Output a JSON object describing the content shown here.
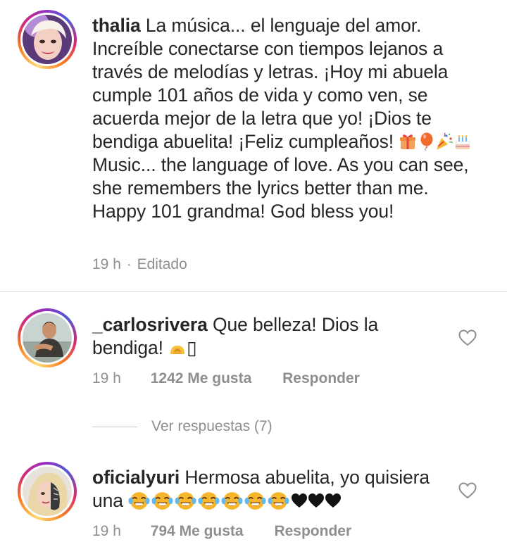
{
  "post": {
    "username": "thalia",
    "caption_p1": " La música... el lenguaje del amor. Increíble conectarse con tiempos lejanos a través de melodías y letras. ¡Hoy mi abuela cumple 101 años de vida y como ven, se acuerda mejor de la letra que yo! ¡Dios te bendiga abuelita! ¡Feliz cumpleaños! ",
    "caption_p2": " Music... the language of love. As you can see, she remembers the lyrics better than me. Happy 101 grandma! God bless you!",
    "time": "19 h",
    "separator": "·",
    "edited": "Editado"
  },
  "comments": [
    {
      "username": "_carlosrivera",
      "text": " Que belleza! Dios la bendiga! ",
      "trailing_glyph": "▯",
      "time": "19 h",
      "likes": "1242 Me gusta",
      "reply": "Responder"
    },
    {
      "username": "oficialyuri",
      "text": " Hermosa abuelita, yo quisiera una ",
      "time": "19 h",
      "likes": "794 Me gusta",
      "reply": "Responder"
    }
  ],
  "view_replies": "Ver respuestas (7)",
  "icons": {
    "like": "heart-outline-icon",
    "emojis": [
      "gift-icon",
      "balloon-icon",
      "party-popper-icon",
      "birthday-cake-icon",
      "bowing-hands-icon",
      "laughing-crying-face-icon",
      "black-heart-icon"
    ]
  },
  "colors": {
    "meta": "#8e8e8e",
    "divider": "#dbdbdb",
    "text": "#262626"
  }
}
